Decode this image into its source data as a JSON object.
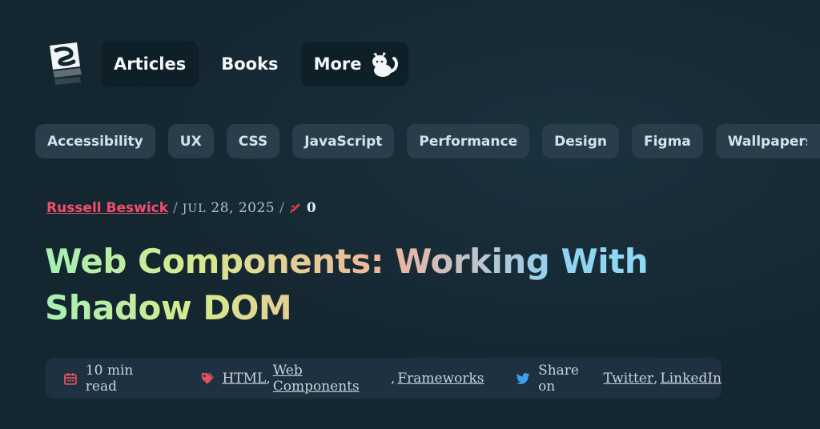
{
  "nav": {
    "items": [
      {
        "label": "Articles"
      },
      {
        "label": "Books"
      },
      {
        "label": "More"
      }
    ]
  },
  "categories": [
    "Accessibility",
    "UX",
    "CSS",
    "JavaScript",
    "Performance",
    "Design",
    "Figma",
    "Wallpapers"
  ],
  "article": {
    "author": "Russell Beswick",
    "date_month": "JUL",
    "date_rest": "28, 2025",
    "comment_count": "0",
    "title": "Web Components: Working With Shadow DOM",
    "read_time": "10 min read",
    "tags": [
      "HTML",
      "Web Components",
      "Frameworks"
    ],
    "share_prefix": "Share on",
    "share_links": [
      "Twitter",
      "LinkedIn"
    ]
  },
  "colors": {
    "background": "#142630",
    "chip": "#2a3d4b",
    "accent_red": "#f0506e",
    "twitter_blue": "#3aa0e8"
  },
  "icons": {
    "logo": "smashing-logo",
    "more": "cat-icon",
    "comments": "comment-quill-icon",
    "read_time": "calendar-icon",
    "tags": "tag-icon",
    "share": "twitter-bird-icon"
  }
}
